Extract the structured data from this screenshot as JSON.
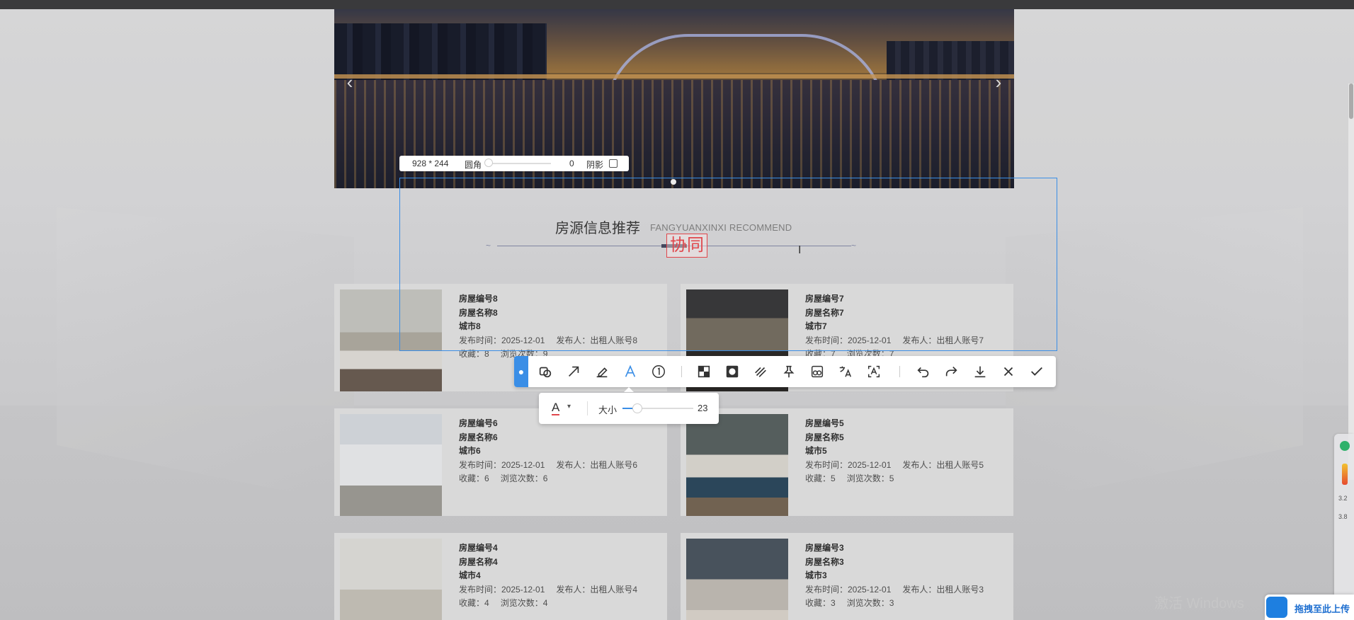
{
  "banner": {
    "prev_arrow": "‹",
    "next_arrow": "›"
  },
  "section": {
    "title_cn": "房源信息推荐",
    "title_en": "FANGYUANXINXI RECOMMEND"
  },
  "capture": {
    "dimensions": "928 * 244",
    "radius_label": "圆角",
    "radius_value": "0",
    "shadow_label": "阴影",
    "stamp_text": "协同"
  },
  "toolbar": {
    "tools": [
      "pointer-icon",
      "shape-icon",
      "arrow-icon",
      "pen-icon",
      "text-icon",
      "number-icon",
      "mosaic-icon",
      "blur-icon",
      "hatch-icon",
      "pin-icon",
      "crop-icon",
      "translate-icon",
      "ocr-icon",
      "undo-icon",
      "redo-icon",
      "download-icon",
      "close-icon",
      "confirm-icon"
    ],
    "active_tool": "text-icon",
    "text_size_label": "大小",
    "text_size_value": "23",
    "text_color": "#e0474c"
  },
  "listings": [
    {
      "id": "房屋编号8",
      "name": "房屋名称8",
      "city": "城市8",
      "date": "发布时间：2025-12-01",
      "publisher": "发布人：出租人账号8",
      "fav": "收藏：8",
      "views": "浏览次数：9"
    },
    {
      "id": "房屋编号7",
      "name": "房屋名称7",
      "city": "城市7",
      "date": "发布时间：2025-12-01",
      "publisher": "发布人：出租人账号7",
      "fav": "收藏：7",
      "views": "浏览次数：7"
    },
    {
      "id": "房屋编号6",
      "name": "房屋名称6",
      "city": "城市6",
      "date": "发布时间：2025-12-01",
      "publisher": "发布人：出租人账号6",
      "fav": "收藏：6",
      "views": "浏览次数：6"
    },
    {
      "id": "房屋编号5",
      "name": "房屋名称5",
      "city": "城市5",
      "date": "发布时间：2025-12-01",
      "publisher": "发布人：出租人账号5",
      "fav": "收藏：5",
      "views": "浏览次数：5"
    },
    {
      "id": "房屋编号4",
      "name": "房屋名称4",
      "city": "城市4",
      "date": "发布时间：2025-12-01",
      "publisher": "发布人：出租人账号4",
      "fav": "收藏：4",
      "views": "浏览次数：4"
    },
    {
      "id": "房屋编号3",
      "name": "房屋名称3",
      "city": "城市3",
      "date": "发布时间：2025-12-01",
      "publisher": "发布人：出租人账号3",
      "fav": "收藏：3",
      "views": "浏览次数：3"
    }
  ],
  "side_widget": {
    "n1": "3.2",
    "n2": "3.8"
  },
  "watermark": "激活 Windows",
  "upload_button": "拖拽至此上传",
  "colors": {
    "accent": "#3a8ee6",
    "stamp": "#e0474c"
  }
}
